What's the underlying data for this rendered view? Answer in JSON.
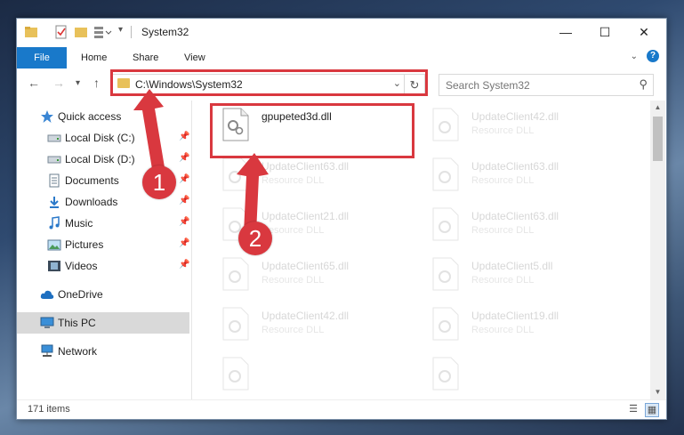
{
  "window": {
    "title": "System32",
    "minimize": "—",
    "maximize": "☐",
    "close": "✕"
  },
  "ribbon": {
    "file": "File",
    "home": "Home",
    "share": "Share",
    "view": "View"
  },
  "address": {
    "path": "C:\\Windows\\System32"
  },
  "search": {
    "placeholder": "Search System32"
  },
  "sidebar": {
    "items": [
      {
        "label": "Quick access",
        "icon": "star-icon",
        "pinned": false
      },
      {
        "label": "Local Disk (C:)",
        "icon": "drive-icon",
        "pinned": true
      },
      {
        "label": "Local Disk (D:)",
        "icon": "drive-icon",
        "pinned": true
      },
      {
        "label": "Documents",
        "icon": "documents-icon",
        "pinned": true
      },
      {
        "label": "Downloads",
        "icon": "download-icon",
        "pinned": true
      },
      {
        "label": "Music",
        "icon": "music-icon",
        "pinned": true
      },
      {
        "label": "Pictures",
        "icon": "pictures-icon",
        "pinned": true
      },
      {
        "label": "Videos",
        "icon": "videos-icon",
        "pinned": true
      },
      {
        "label": "OneDrive",
        "icon": "cloud-icon",
        "pinned": false
      },
      {
        "label": "This PC",
        "icon": "computer-icon",
        "pinned": false,
        "selected": true
      },
      {
        "label": "Network",
        "icon": "network-icon",
        "pinned": false
      }
    ]
  },
  "files": [
    {
      "name": "gpupeted3d.dll",
      "type": ""
    },
    {
      "name": "UpdateClient42.dll",
      "type": "Resource DLL"
    },
    {
      "name": "UpdateClient63.dll",
      "type": "Resource DLL"
    },
    {
      "name": "UpdateClient63.dll",
      "type": "Resource DLL"
    },
    {
      "name": "UpdateClient21.dll",
      "type": "Resource DLL"
    },
    {
      "name": "UpdateClient63.dll",
      "type": "Resource DLL"
    },
    {
      "name": "UpdateClient65.dll",
      "type": "Resource DLL"
    },
    {
      "name": "UpdateClient5.dll",
      "type": "Resource DLL"
    },
    {
      "name": "UpdateClient42.dll",
      "type": "Resource DLL"
    },
    {
      "name": "UpdateClient19.dll",
      "type": "Resource DLL"
    }
  ],
  "status": {
    "count": "171 items"
  },
  "annotations": {
    "step1": "1",
    "step2": "2",
    "color": "#d9383f"
  }
}
